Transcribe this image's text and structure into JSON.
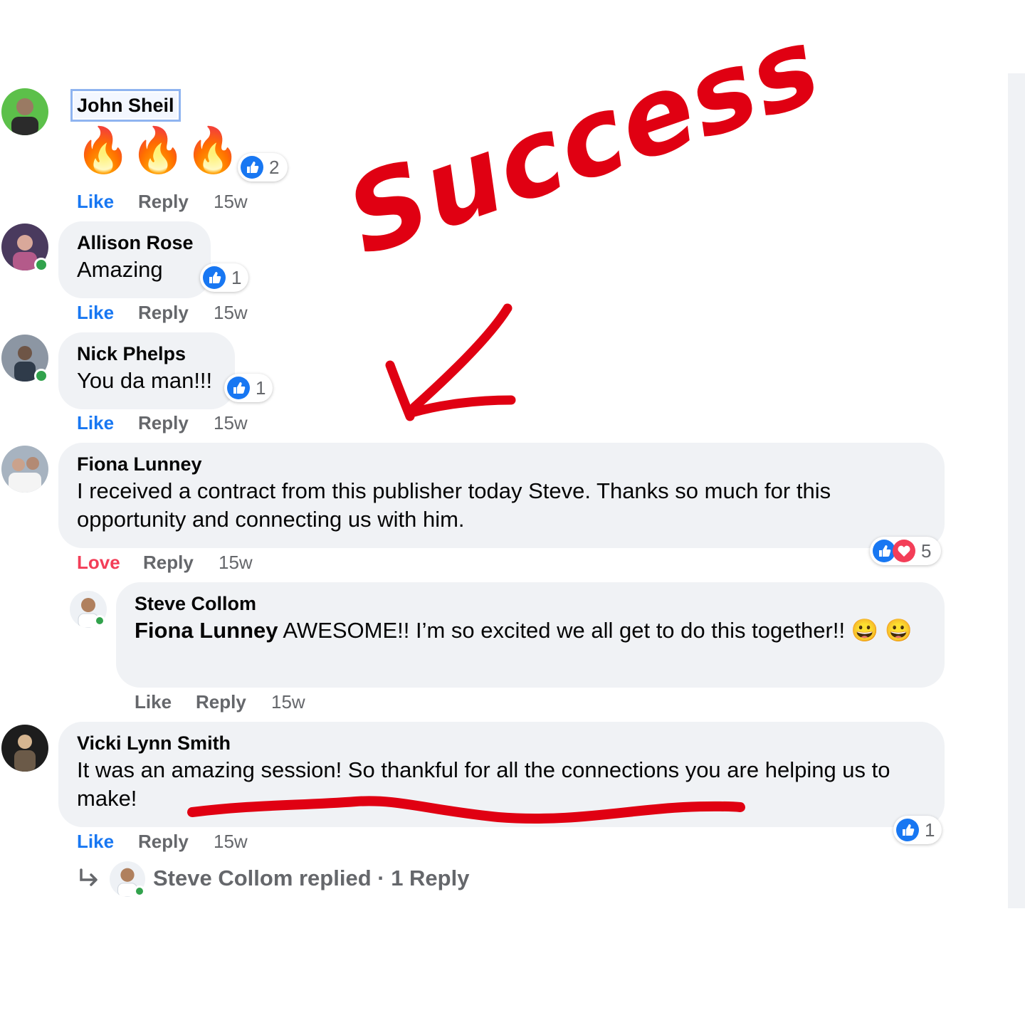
{
  "annotation": {
    "headline": "Success",
    "color": "#e00012"
  },
  "colors": {
    "accent": "#1877f2",
    "love": "#f33e58",
    "bubble": "#f0f2f5",
    "muted": "#65676b"
  },
  "comments": [
    {
      "author": "John Sheil",
      "emojis": "🔥🔥🔥",
      "reaction_count": "2",
      "reaction_types": [
        "like-icon"
      ],
      "actions": {
        "like": "Like",
        "reply": "Reply",
        "time": "15w"
      }
    },
    {
      "author": "Allison Rose",
      "text": "Amazing",
      "reaction_count": "1",
      "reaction_types": [
        "like-icon"
      ],
      "actions": {
        "like": "Like",
        "reply": "Reply",
        "time": "15w"
      }
    },
    {
      "author": "Nick Phelps",
      "text": "You da man!!!",
      "reaction_count": "1",
      "reaction_types": [
        "like-icon"
      ],
      "actions": {
        "like": "Like",
        "reply": "Reply",
        "time": "15w"
      }
    },
    {
      "author": "Fiona Lunney",
      "text": "I received a contract from this publisher today Steve. Thanks so much for this opportunity and connecting us with him.",
      "reaction_count": "5",
      "reaction_types": [
        "like-icon",
        "love-icon"
      ],
      "actions": {
        "like": "Love",
        "reply": "Reply",
        "time": "15w"
      }
    },
    {
      "author": "Steve Collom",
      "mention": "Fiona Lunney",
      "text": " AWESOME!! I’m so excited we all get to do this together!! ",
      "emoji": "😀",
      "actions": {
        "like": "Like",
        "reply": "Reply",
        "time": "15w"
      }
    },
    {
      "author": "Vicki Lynn Smith",
      "text": "It was an amazing session! So thankful for all the connections you are helping us to make!",
      "reaction_count": "1",
      "reaction_types": [
        "like-icon"
      ],
      "actions": {
        "like": "Like",
        "reply": "Reply",
        "time": "15w"
      }
    }
  ],
  "replies_link": {
    "text": "Steve Collom replied · 1 Reply"
  }
}
